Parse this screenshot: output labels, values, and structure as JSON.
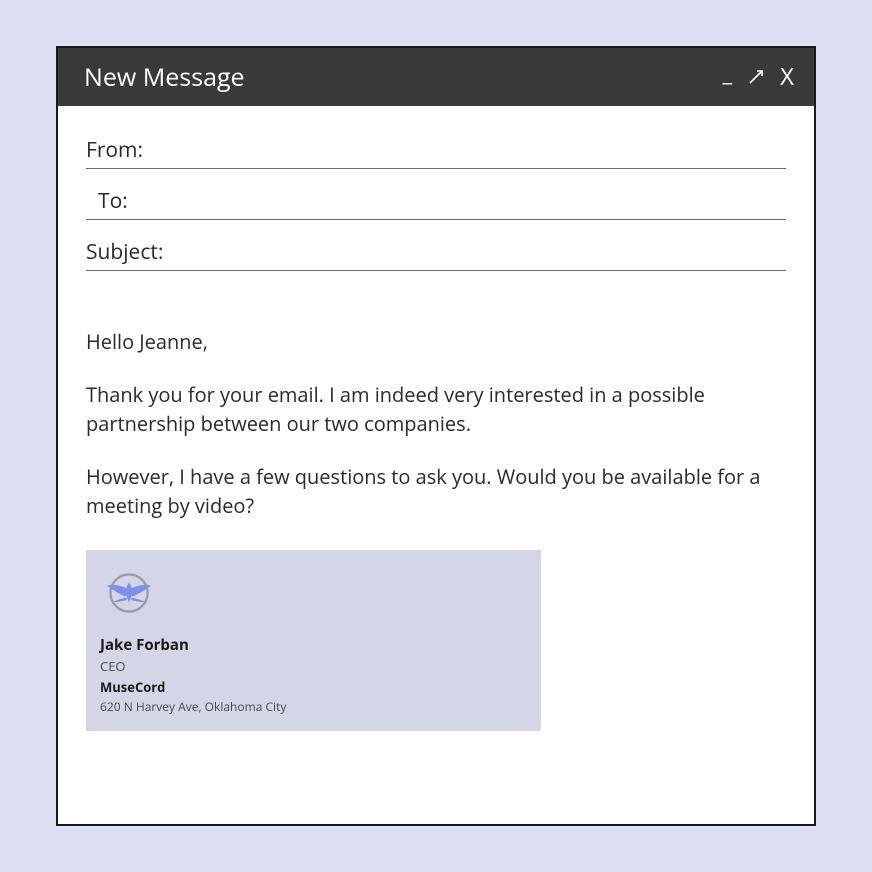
{
  "window": {
    "title": "New Message"
  },
  "fields": {
    "from_label": "From:",
    "from_value": "",
    "to_label": "To:",
    "to_value": "",
    "subject_label": "Subject:",
    "subject_value": ""
  },
  "body": {
    "greeting": "Hello Jeanne,",
    "para1": "Thank you for your email. I am indeed very interested in a possible partnership between our two companies.",
    "para2": "However, I have a few questions to ask you. Would you be available for a meeting by video?"
  },
  "signature": {
    "name": "Jake Forban",
    "title": "CEO",
    "company": "MuseCord",
    "address": "620 N Harvey Ave, Oklahoma City",
    "logo_name": "phoenix-logo"
  },
  "icons": {
    "minimize": "_",
    "expand": "↗",
    "close": "X"
  }
}
